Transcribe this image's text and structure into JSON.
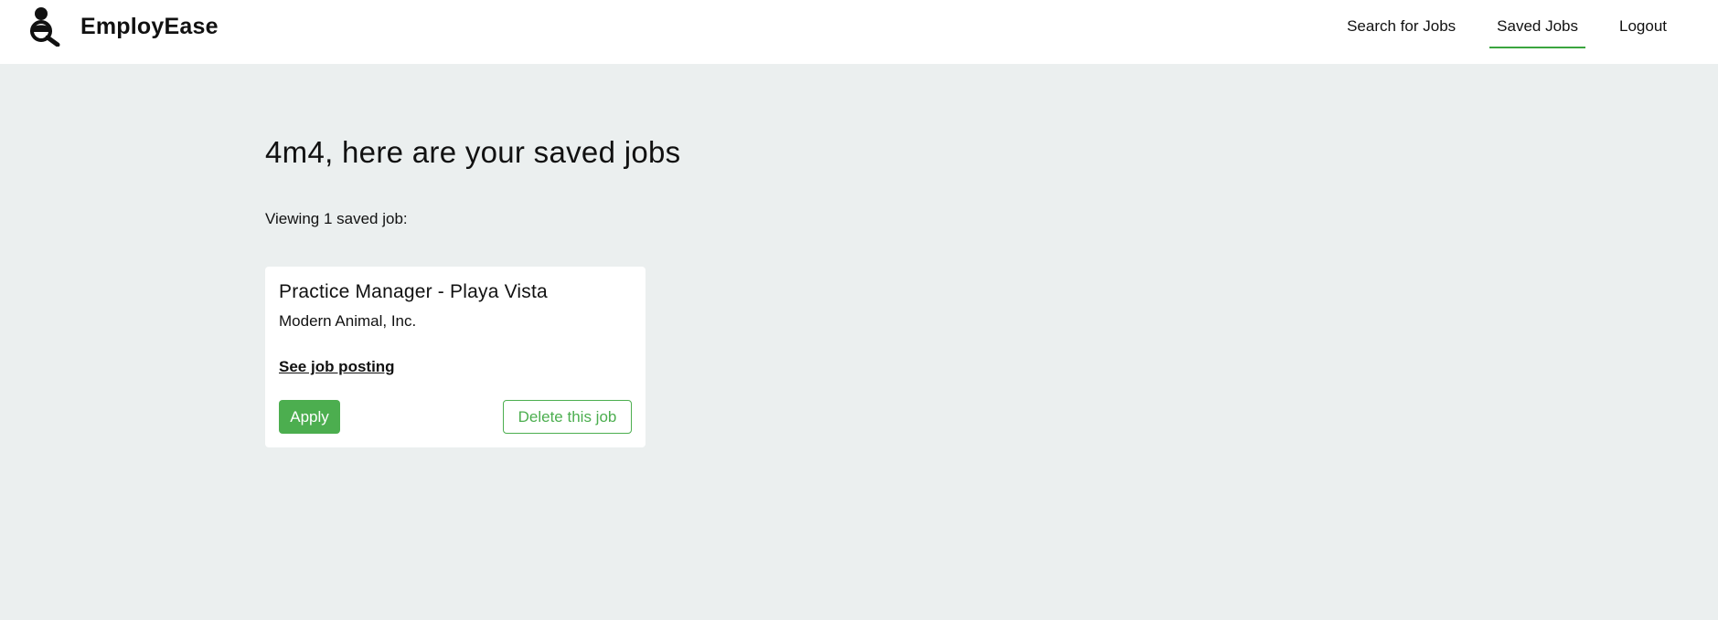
{
  "header": {
    "brand_name": "EmployEase",
    "brand_icon": "person-magnifier-icon",
    "nav": [
      {
        "label": "Search for Jobs",
        "active": false
      },
      {
        "label": "Saved Jobs",
        "active": true
      },
      {
        "label": "Logout",
        "active": false
      }
    ]
  },
  "main": {
    "title": "4m4, here are your saved jobs",
    "viewing_text": "Viewing 1 saved job:",
    "jobs": [
      {
        "title": "Practice Manager - Playa Vista",
        "company": "Modern Animal, Inc.",
        "link_label": "See job posting",
        "apply_label": "Apply",
        "delete_label": "Delete this job"
      }
    ]
  },
  "colors": {
    "background": "#ebefef",
    "accent_green": "#4cae4f",
    "nav_underline": "#3aa53f"
  }
}
